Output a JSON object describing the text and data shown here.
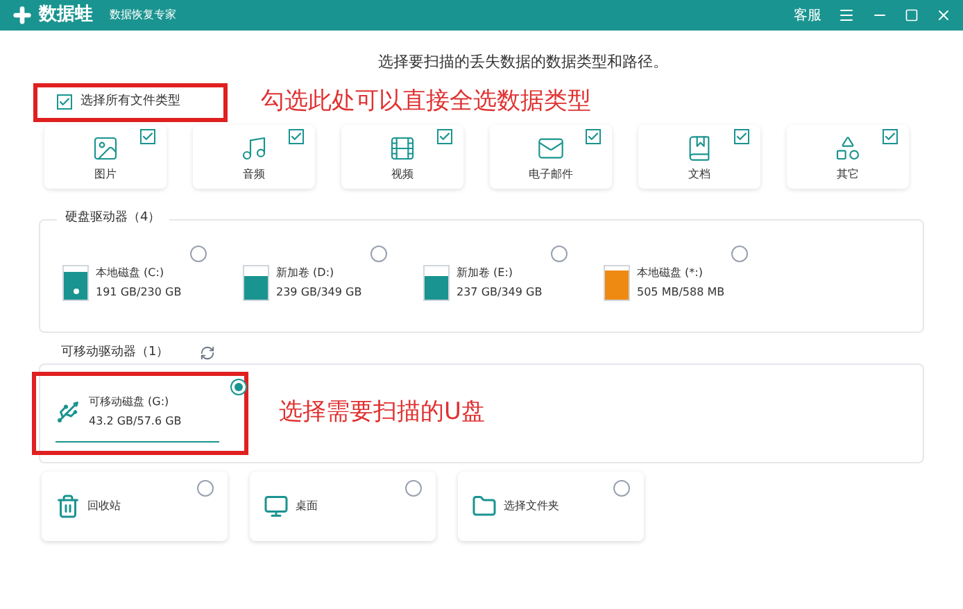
{
  "title_bar": {
    "app_name": "数据蛙",
    "subtitle": "数据恢复专家",
    "service": "客服"
  },
  "heading": "选择要扫描的丢失数据的数据类型和路径。",
  "select_all": {
    "label": "选择所有文件类型",
    "checked": true
  },
  "annotations": [
    {
      "text": "勾选此处可以直接全选数据类型"
    },
    {
      "text": "选择需要扫描的U盘"
    }
  ],
  "file_types": [
    {
      "kind": "image",
      "label": "图片",
      "checked": true
    },
    {
      "kind": "audio",
      "label": "音频",
      "checked": true
    },
    {
      "kind": "video",
      "label": "视频",
      "checked": true
    },
    {
      "kind": "email",
      "label": "电子邮件",
      "checked": true
    },
    {
      "kind": "document",
      "label": "文档",
      "checked": true
    },
    {
      "kind": "other",
      "label": "其它",
      "checked": true
    }
  ],
  "hard_drives": {
    "title": "硬盘驱动器（4）",
    "drives": [
      {
        "name": "本地磁盘 (C:)",
        "size": "191 GB/230 GB",
        "level": 0.83,
        "color": "#1a9490",
        "system": true,
        "selected": false
      },
      {
        "name": "新加卷 (D:)",
        "size": "239 GB/349 GB",
        "level": 0.68,
        "color": "#1a9490",
        "system": false,
        "selected": false
      },
      {
        "name": "新加卷 (E:)",
        "size": "237 GB/349 GB",
        "level": 0.68,
        "color": "#1a9490",
        "system": false,
        "selected": false
      },
      {
        "name": "本地磁盘 (*:)",
        "size": "505 MB/588 MB",
        "level": 0.86,
        "color": "#ee8a12",
        "system": false,
        "selected": false
      }
    ]
  },
  "removable_drives": {
    "title": "可移动驱动器（1）",
    "drives": [
      {
        "name": "可移动磁盘 (G:)",
        "size": "43.2 GB/57.6 GB",
        "selected": true
      }
    ]
  },
  "locations": [
    {
      "kind": "recycle",
      "label": "回收站",
      "selected": false
    },
    {
      "kind": "desktop",
      "label": "桌面",
      "selected": false
    },
    {
      "kind": "folder",
      "label": "选择文件夹",
      "selected": false
    }
  ]
}
